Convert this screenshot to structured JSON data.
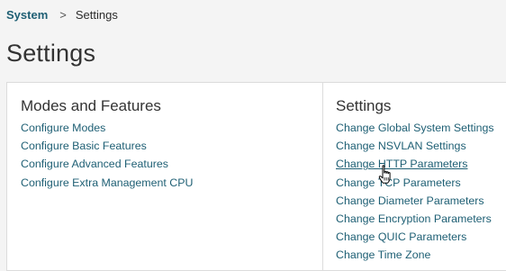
{
  "breadcrumb": {
    "parent": "System",
    "separator": ">",
    "current": "Settings"
  },
  "page_title": "Settings",
  "modes_features": {
    "title": "Modes and Features",
    "links": [
      "Configure Modes",
      "Configure Basic Features",
      "Configure Advanced Features",
      "Configure Extra Management CPU"
    ]
  },
  "settings": {
    "title": "Settings",
    "links": [
      "Change Global System Settings",
      "Change NSVLAN Settings",
      "Change HTTP Parameters",
      "Change TCP Parameters",
      "Change Diameter Parameters",
      "Change Encryption Parameters",
      "Change QUIC Parameters",
      "Change Time Zone"
    ]
  },
  "icons": {
    "cursor": "hand-pointer-icon"
  },
  "colors": {
    "link": "#1e5f74",
    "background": "#f4f4f4",
    "panel": "#ffffff"
  }
}
